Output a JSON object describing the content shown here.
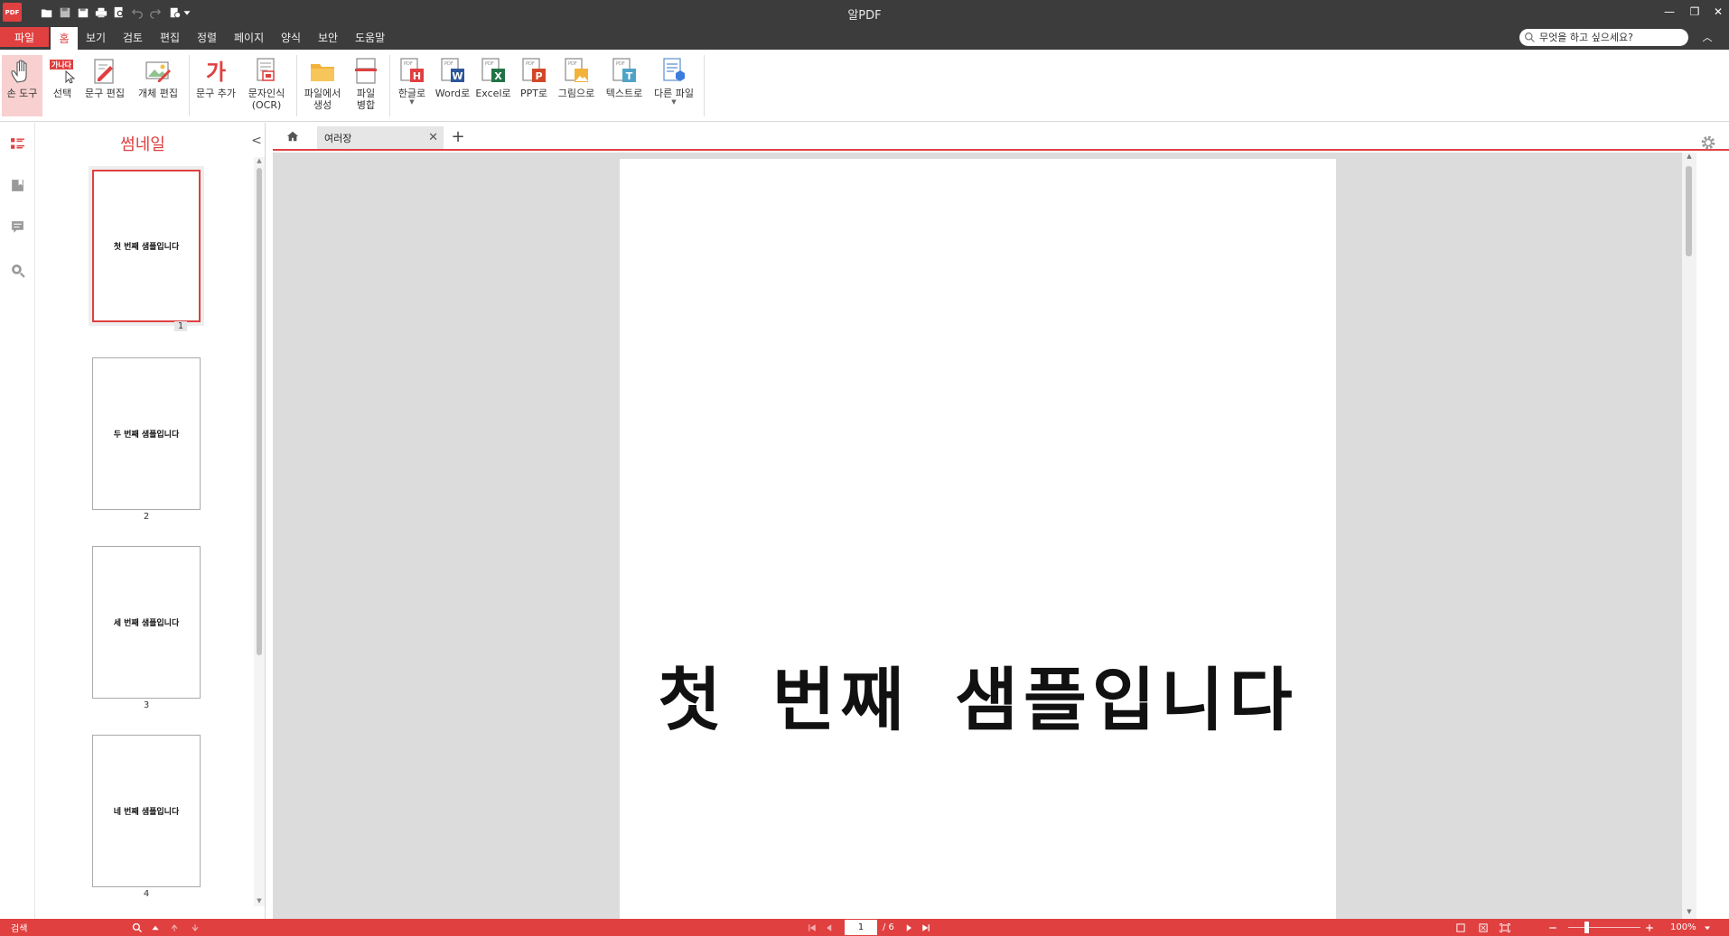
{
  "app": {
    "logo": "PDF",
    "title": "알PDF"
  },
  "quick_access": [
    "open-icon",
    "save-icon",
    "save-all-icon",
    "print-icon",
    "print-preview-icon",
    "undo-icon",
    "redo-icon",
    "options-icon",
    "customize-icon"
  ],
  "menu": {
    "file": "파일",
    "home": "홈",
    "items": [
      "보기",
      "검토",
      "편집",
      "정렬",
      "페이지",
      "양식",
      "보안",
      "도움말"
    ]
  },
  "search": {
    "placeholder": "무엇을 하고 싶으세요?"
  },
  "ribbon": {
    "hand_tool": "손 도구",
    "select": "선택",
    "select_badge": "가나다",
    "edit_text": "문구 편집",
    "edit_object": "개체 편집",
    "add_text": "문구 추가",
    "add_text_glyph": "가",
    "ocr_line1": "문자인식",
    "ocr_line2": "(OCR)",
    "create_from_file_line1": "파일에서",
    "create_from_file_line2": "생성",
    "merge_line1": "파일",
    "merge_line2": "병합",
    "to_hangul": "한글로",
    "to_word": "Word로",
    "to_excel": "Excel로",
    "to_ppt": "PPT로",
    "to_image": "그림으로",
    "to_text": "텍스트로",
    "other_file": "다른 파일"
  },
  "thumbnails": {
    "title": "썸네일",
    "pages": [
      {
        "text": "첫 번째 샘플입니다",
        "num": "1",
        "selected": true
      },
      {
        "text": "두 번째 샘플입니다",
        "num": "2",
        "selected": false
      },
      {
        "text": "세 번째 샘플입니다",
        "num": "3",
        "selected": false
      },
      {
        "text": "네 번째 샘플입니다",
        "num": "4",
        "selected": false
      }
    ]
  },
  "tabs": {
    "doc_tab": "여러장"
  },
  "document": {
    "page_text": "첫 번째 샘플입니다"
  },
  "status": {
    "search_label": "검색",
    "current_page": "1",
    "total_pages": "/ 6",
    "zoom": "100%",
    "zoom_level_percent": 100
  },
  "colors": {
    "accent": "#e04040",
    "titlebar": "#3c3c3c",
    "doc_bg": "#dcdcdc"
  }
}
